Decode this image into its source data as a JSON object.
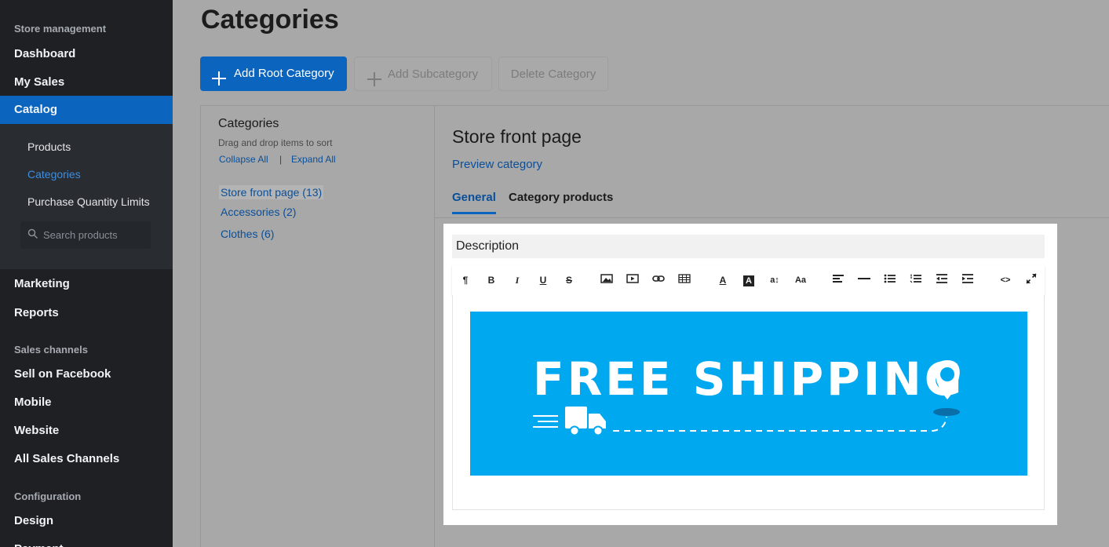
{
  "sidebar": {
    "section_store": "Store management",
    "dashboard": "Dashboard",
    "my_sales": "My Sales",
    "catalog": "Catalog",
    "sub": {
      "products": "Products",
      "categories": "Categories",
      "purchase_limits": "Purchase Quantity Limits",
      "search_placeholder": "Search products"
    },
    "marketing": "Marketing",
    "reports": "Reports",
    "section_channels": "Sales channels",
    "sell_facebook": "Sell on Facebook",
    "mobile": "Mobile",
    "website": "Website",
    "all_channels": "All Sales Channels",
    "section_config": "Configuration",
    "design": "Design",
    "payment": "Payment"
  },
  "main": {
    "title": "Categories",
    "buttons": {
      "add_root": "Add Root Category",
      "add_sub": "Add Subcategory",
      "delete": "Delete Category"
    }
  },
  "tree_panel": {
    "title": "Categories",
    "hint": "Drag and drop items to sort",
    "collapse_all": "Collapse All",
    "separator": "|",
    "expand_all": "Expand All",
    "items": [
      {
        "label": "Store front page (13)"
      },
      {
        "label": "Accessories (2)"
      },
      {
        "label": "Clothes (6)"
      }
    ]
  },
  "detail": {
    "title": "Store front page",
    "preview_link": "Preview category",
    "tabs": [
      "General",
      "Category products"
    ],
    "active_tab": "General",
    "description_label": "Description"
  },
  "editor": {
    "toolbar_icons": [
      "paragraph-icon",
      "bold-icon",
      "italic-icon",
      "underline-icon",
      "strikethrough-icon",
      "image-icon",
      "video-icon",
      "link-icon",
      "table-icon",
      "font-color-icon",
      "background-color-icon",
      "font-size-icon",
      "font-family-icon",
      "align-icon",
      "horizontal-rule-icon",
      "unordered-list-icon",
      "ordered-list-icon",
      "outdent-icon",
      "indent-icon",
      "code-view-icon",
      "fullscreen-icon"
    ],
    "banner_text": "FREE SHIPPING",
    "banner_color": "#00a8f0"
  },
  "colors": {
    "accent": "#0b64bd",
    "sidebar_bg": "#1e2024"
  }
}
